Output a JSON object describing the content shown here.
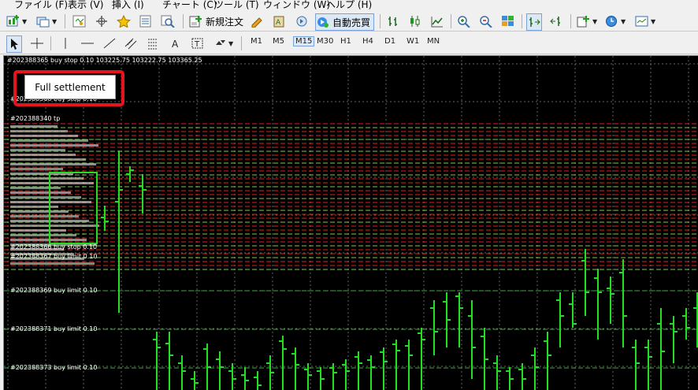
{
  "menu": [
    "ファイル (F)",
    "表示 (V)",
    "挿入 (I)",
    "チャート (C)",
    "ツール (T)",
    "ウィンドウ (W)",
    "ヘルプ (H)"
  ],
  "toolbar": {
    "new_order_label": "新規注文",
    "auto_trade_label": "自動売買"
  },
  "timeframes": [
    "M1",
    "M5",
    "M15",
    "M30",
    "H1",
    "H4",
    "D1",
    "W1",
    "MN"
  ],
  "active_timeframe": "M15",
  "chart": {
    "header_text": "#202388365 buy stop 0.10 103225.75 103222.75 103365.25",
    "settlement_button_label": "Full settlement",
    "colors": {
      "background": "#000000",
      "candles": "#22dd22",
      "order_lines": "#e02020",
      "highlight_frame": "#e8141c"
    },
    "order_labels": [
      "#202388368 buy stop 0.10",
      "#202388340 tp",
      "#202388366 buy stop 0.10",
      "#202388367 buy limit 0.10",
      "#202388369 buy limit 0.10",
      "#202388371 buy limit 0.10",
      "#202388373 buy limit 0.10"
    ]
  }
}
